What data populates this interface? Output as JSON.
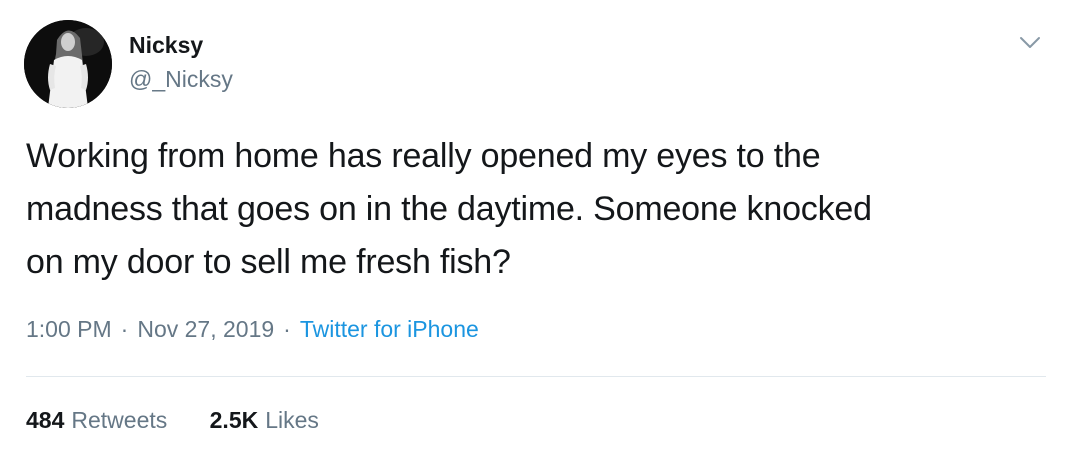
{
  "tweet": {
    "author": {
      "name": "Nicksy",
      "handle": "@_Nicksy",
      "avatar": "profile-photo"
    },
    "menu_icon": "chevron-down-icon",
    "text_lines": [
      "Working from home has really opened my eyes to the",
      "madness that goes on in the daytime. Someone knocked",
      "on my door to sell me fresh fish?"
    ],
    "time": "1:00 PM",
    "separator": "·",
    "date": "Nov 27, 2019",
    "source": "Twitter for iPhone",
    "stats": {
      "retweets_count": "484",
      "retweets_label": "Retweets",
      "likes_count": "2.5K",
      "likes_label": "Likes"
    }
  },
  "colors": {
    "text": "#14171a",
    "secondary": "#657786",
    "link": "#1b95e0",
    "divider": "#e1e8ed"
  }
}
